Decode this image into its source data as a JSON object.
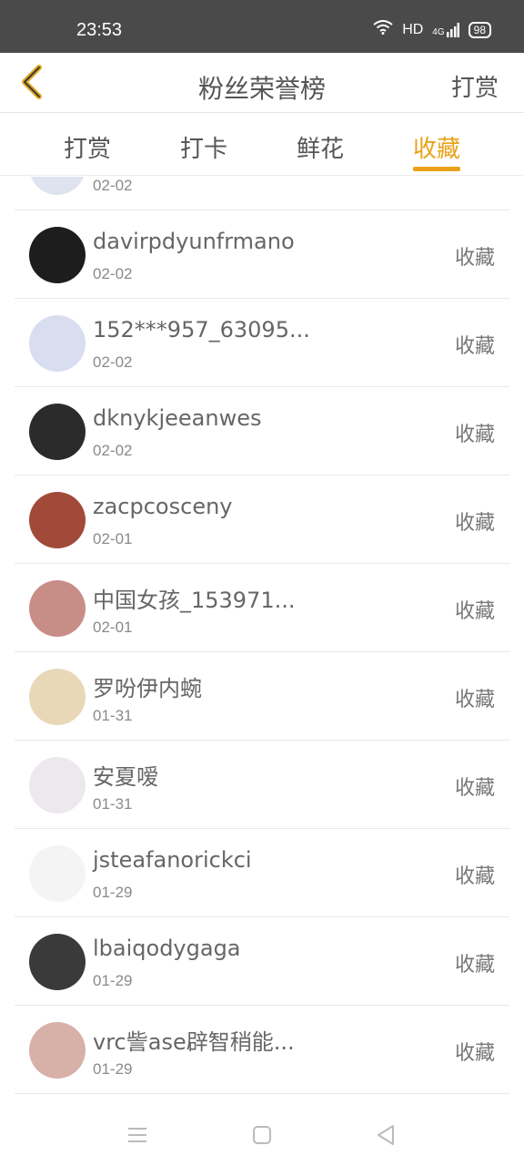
{
  "status": {
    "time": "23:53",
    "network": "HD",
    "signal": "4G",
    "battery": "98"
  },
  "header": {
    "title": "粉丝荣誉榜",
    "right_label": "打赏"
  },
  "tabs": [
    {
      "label": "打赏",
      "active": false
    },
    {
      "label": "打卡",
      "active": false
    },
    {
      "label": "鲜花",
      "active": false
    },
    {
      "label": "收藏",
      "active": true
    }
  ],
  "list": [
    {
      "name": "",
      "date": "02-02",
      "action": "",
      "avatar_color": "#dfe3f0"
    },
    {
      "name": "davirpdyunfrmano",
      "date": "02-02",
      "action": "收藏",
      "avatar_color": "#1d1d1d"
    },
    {
      "name": "152***957_63095...",
      "date": "02-02",
      "action": "收藏",
      "avatar_color": "#d8def0"
    },
    {
      "name": "dknykjeeanwes",
      "date": "02-02",
      "action": "收藏",
      "avatar_color": "#2b2b2b"
    },
    {
      "name": "zacpcosceny",
      "date": "02-01",
      "action": "收藏",
      "avatar_color": "#a14a3a"
    },
    {
      "name": "中国女孩_153971...",
      "date": "02-01",
      "action": "收藏",
      "avatar_color": "#c98d88"
    },
    {
      "name": "罗吩伊内蜿",
      "date": "01-31",
      "action": "收藏",
      "avatar_color": "#e8d8b8"
    },
    {
      "name": "安夏嗳",
      "date": "01-31",
      "action": "收藏",
      "avatar_color": "#ede8ee"
    },
    {
      "name": "jsteafanorickci",
      "date": "01-29",
      "action": "收藏",
      "avatar_color": "#f4f4f4"
    },
    {
      "name": "lbaiqodygaga",
      "date": "01-29",
      "action": "收藏",
      "avatar_color": "#3a3a3a"
    },
    {
      "name": "vrc訾ase辟智稍能...",
      "date": "01-29",
      "action": "收藏",
      "avatar_color": "#d7b0a8"
    }
  ],
  "colors": {
    "accent": "#e9a21a",
    "status_bar": "#4a4a4a",
    "text": "#666666"
  },
  "icons": {
    "back": "chevron-left-icon",
    "menu": "menu-icon",
    "home": "home-square-icon",
    "back_nav": "back-triangle-icon"
  }
}
